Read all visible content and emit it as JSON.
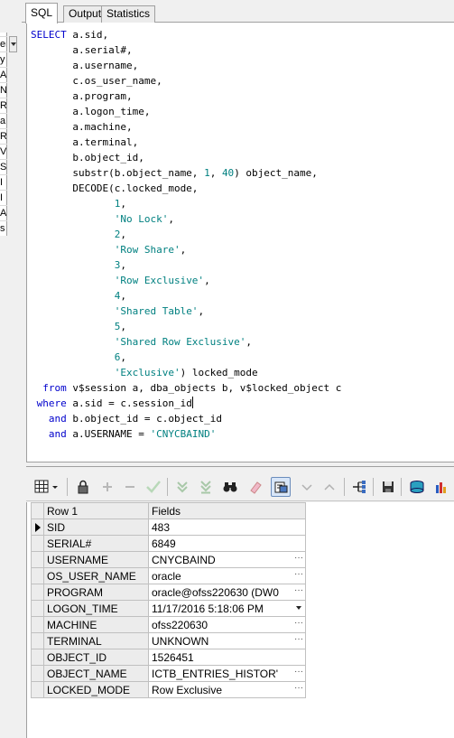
{
  "left_pane": {
    "strip_chars": [
      "er",
      "y",
      "A",
      "N",
      "R",
      "a",
      "R",
      "V",
      "S",
      "I",
      "I",
      "A",
      "s"
    ]
  },
  "tabs": [
    {
      "label": "SQL",
      "active": true
    },
    {
      "label": "Output",
      "active": false
    },
    {
      "label": "Statistics",
      "active": false
    }
  ],
  "editor": {
    "lines": [
      [
        {
          "t": "SELECT",
          "c": "kw"
        },
        {
          "t": " a.sid,",
          "c": ""
        }
      ],
      [
        {
          "t": "       a.serial#,",
          "c": ""
        }
      ],
      [
        {
          "t": "       a.username,",
          "c": ""
        }
      ],
      [
        {
          "t": "       c.os_user_name,",
          "c": ""
        }
      ],
      [
        {
          "t": "       a.program,",
          "c": ""
        }
      ],
      [
        {
          "t": "       a.logon_time,",
          "c": ""
        }
      ],
      [
        {
          "t": "       a.machine,",
          "c": ""
        }
      ],
      [
        {
          "t": "       a.terminal,",
          "c": ""
        }
      ],
      [
        {
          "t": "       b.object_id,",
          "c": ""
        }
      ],
      [
        {
          "t": "       substr(b.object_name, ",
          "c": ""
        },
        {
          "t": "1",
          "c": "num"
        },
        {
          "t": ", ",
          "c": ""
        },
        {
          "t": "40",
          "c": "num"
        },
        {
          "t": ") object_name,",
          "c": ""
        }
      ],
      [
        {
          "t": "       DECODE(c.locked_mode,",
          "c": ""
        }
      ],
      [
        {
          "t": "              ",
          "c": ""
        },
        {
          "t": "1",
          "c": "num"
        },
        {
          "t": ",",
          "c": ""
        }
      ],
      [
        {
          "t": "              ",
          "c": ""
        },
        {
          "t": "'No Lock'",
          "c": "str"
        },
        {
          "t": ",",
          "c": ""
        }
      ],
      [
        {
          "t": "              ",
          "c": ""
        },
        {
          "t": "2",
          "c": "num"
        },
        {
          "t": ",",
          "c": ""
        }
      ],
      [
        {
          "t": "              ",
          "c": ""
        },
        {
          "t": "'Row Share'",
          "c": "str"
        },
        {
          "t": ",",
          "c": ""
        }
      ],
      [
        {
          "t": "              ",
          "c": ""
        },
        {
          "t": "3",
          "c": "num"
        },
        {
          "t": ",",
          "c": ""
        }
      ],
      [
        {
          "t": "              ",
          "c": ""
        },
        {
          "t": "'Row Exclusive'",
          "c": "str"
        },
        {
          "t": ",",
          "c": ""
        }
      ],
      [
        {
          "t": "              ",
          "c": ""
        },
        {
          "t": "4",
          "c": "num"
        },
        {
          "t": ",",
          "c": ""
        }
      ],
      [
        {
          "t": "              ",
          "c": ""
        },
        {
          "t": "'Shared Table'",
          "c": "str"
        },
        {
          "t": ",",
          "c": ""
        }
      ],
      [
        {
          "t": "              ",
          "c": ""
        },
        {
          "t": "5",
          "c": "num"
        },
        {
          "t": ",",
          "c": ""
        }
      ],
      [
        {
          "t": "              ",
          "c": ""
        },
        {
          "t": "'Shared Row Exclusive'",
          "c": "str"
        },
        {
          "t": ",",
          "c": ""
        }
      ],
      [
        {
          "t": "              ",
          "c": ""
        },
        {
          "t": "6",
          "c": "num"
        },
        {
          "t": ",",
          "c": ""
        }
      ],
      [
        {
          "t": "              ",
          "c": ""
        },
        {
          "t": "'Exclusive'",
          "c": "str"
        },
        {
          "t": ") locked_mode",
          "c": ""
        }
      ],
      [
        {
          "t": "  ",
          "c": ""
        },
        {
          "t": "from",
          "c": "kw"
        },
        {
          "t": " v$session a, dba_objects b, v$locked_object c",
          "c": ""
        }
      ],
      [
        {
          "t": " ",
          "c": ""
        },
        {
          "t": "where",
          "c": "kw"
        },
        {
          "t": " a.sid = c.session_id",
          "c": "",
          "caret": true
        }
      ],
      [
        {
          "t": "   ",
          "c": ""
        },
        {
          "t": "and",
          "c": "kw"
        },
        {
          "t": " b.object_id = c.object_id",
          "c": ""
        }
      ],
      [
        {
          "t": "   ",
          "c": ""
        },
        {
          "t": "and",
          "c": "kw"
        },
        {
          "t": " a.USERNAME = ",
          "c": ""
        },
        {
          "t": "'CNYCBAIND'",
          "c": "str"
        }
      ]
    ]
  },
  "toolbar": {
    "buttons": [
      {
        "name": "grid-layout-icon"
      },
      {
        "name": "lock-icon"
      },
      {
        "name": "add-record-icon"
      },
      {
        "name": "delete-record-icon"
      },
      {
        "name": "post-edit-icon"
      },
      {
        "name": "fetch-next-page-icon"
      },
      {
        "name": "fetch-all-icon"
      },
      {
        "name": "find-binoculars-icon"
      },
      {
        "name": "clear-eraser-icon"
      },
      {
        "name": "single-record-view-icon"
      },
      {
        "name": "next-record-icon"
      },
      {
        "name": "previous-record-icon"
      },
      {
        "name": "query-plan-icon"
      },
      {
        "name": "save-icon"
      },
      {
        "name": "export-icon"
      },
      {
        "name": "chart-icon"
      }
    ]
  },
  "grid": {
    "header_row": "Row 1",
    "header_fields": "Fields",
    "rows": [
      {
        "field": "SID",
        "value": "483",
        "editor": "none"
      },
      {
        "field": "SERIAL#",
        "value": "6849",
        "editor": "none"
      },
      {
        "field": "USERNAME",
        "value": "CNYCBAIND",
        "editor": "ellipsis"
      },
      {
        "field": "OS_USER_NAME",
        "value": "oracle",
        "editor": "ellipsis"
      },
      {
        "field": "PROGRAM",
        "value": "oracle@ofss220630 (DW0",
        "editor": "ellipsis"
      },
      {
        "field": "LOGON_TIME",
        "value": "11/17/2016 5:18:06 PM",
        "editor": "dropdown"
      },
      {
        "field": "MACHINE",
        "value": "ofss220630",
        "editor": "ellipsis"
      },
      {
        "field": "TERMINAL",
        "value": "UNKNOWN",
        "editor": "ellipsis"
      },
      {
        "field": "OBJECT_ID",
        "value": "1526451",
        "editor": "none"
      },
      {
        "field": "OBJECT_NAME",
        "value": "ICTB_ENTRIES_HISTOR'",
        "editor": "ellipsis"
      },
      {
        "field": "LOCKED_MODE",
        "value": "Row Exclusive",
        "editor": "ellipsis"
      }
    ]
  },
  "colors": {
    "keyword": "#0000cc",
    "string": "#008080",
    "grid_border": "#c0c0c0"
  }
}
